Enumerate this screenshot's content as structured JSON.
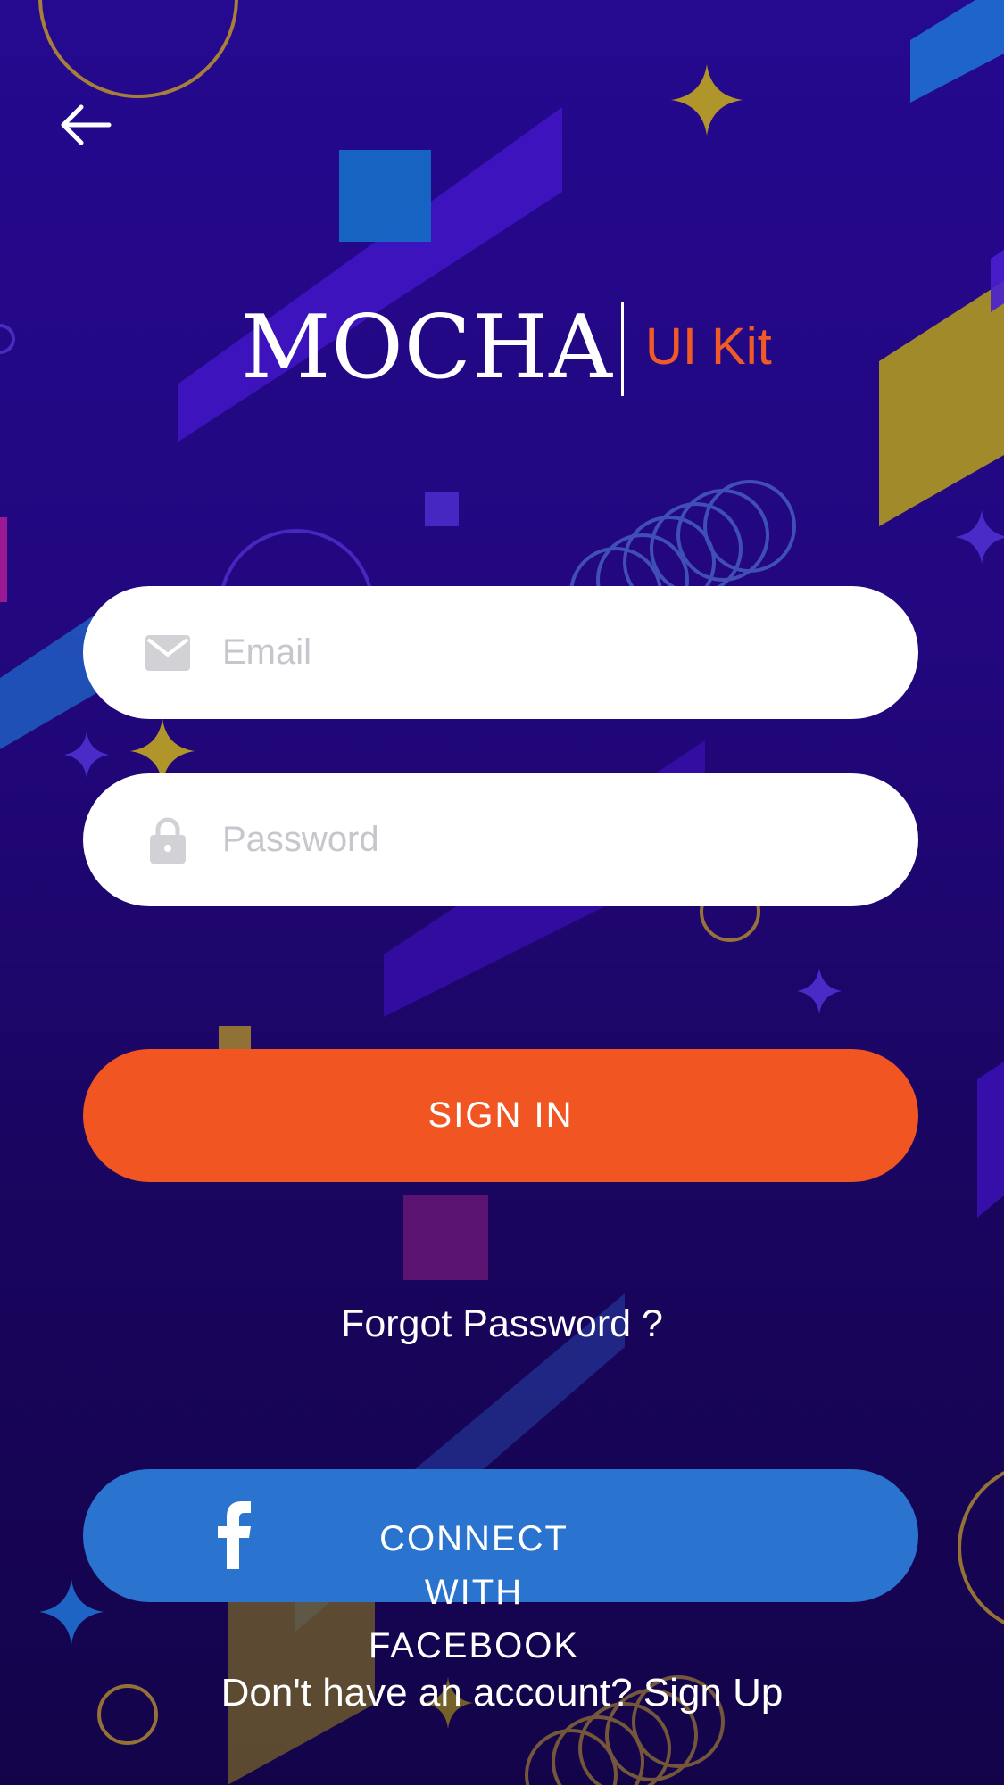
{
  "logo": {
    "wordmark": "MOCHA",
    "subtitle": "UI Kit"
  },
  "form": {
    "email_placeholder": "Email",
    "password_placeholder": "Password",
    "email_icon": "envelope-icon",
    "password_icon": "lock-icon"
  },
  "actions": {
    "sign_in_label": "SIGN IN",
    "forgot_password_label": "Forgot Password ?",
    "facebook_label": "CONNECT WITH FACEBOOK",
    "facebook_icon": "facebook-icon",
    "signup_label": "Don't have an account? Sign Up"
  },
  "navigation": {
    "back_icon": "arrow-left-icon"
  },
  "colors": {
    "accent": "#f05a26",
    "facebook": "#2a74cf",
    "background_top": "#25098f",
    "background_bottom": "#13044a"
  }
}
